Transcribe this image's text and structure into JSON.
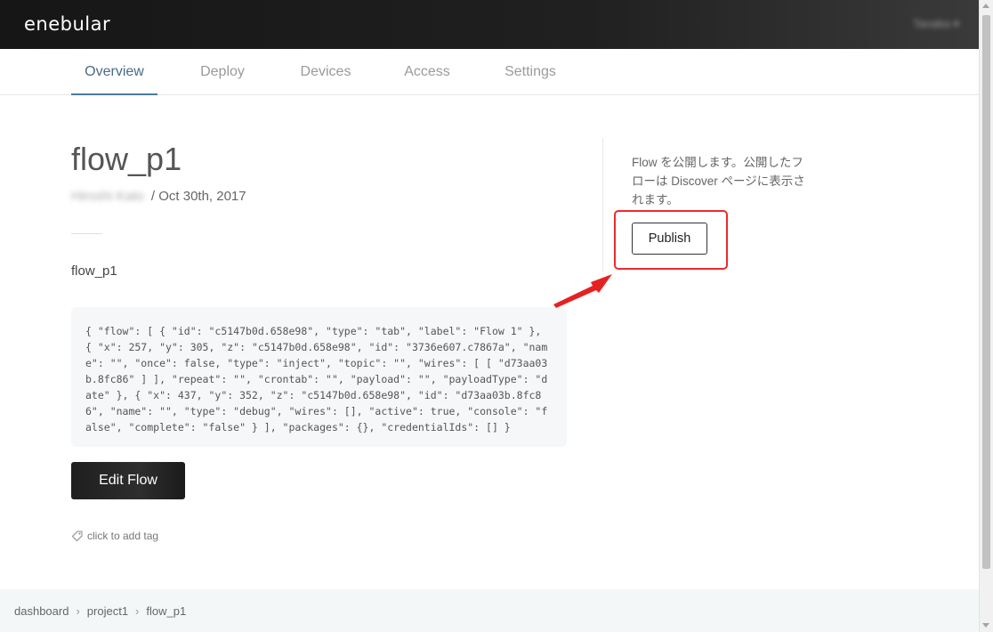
{
  "app": {
    "logo": "enebular",
    "user": "Tanaka"
  },
  "tabs": [
    {
      "label": "Overview",
      "active": true
    },
    {
      "label": "Deploy",
      "active": false
    },
    {
      "label": "Devices",
      "active": false
    },
    {
      "label": "Access",
      "active": false
    },
    {
      "label": "Settings",
      "active": false
    }
  ],
  "flow": {
    "title": "flow_p1",
    "author": "Hiroshi Kato",
    "date_sep": " / ",
    "date": "Oct 30th, 2017",
    "description": "flow_p1",
    "json": "{ \"flow\": [ { \"id\": \"c5147b0d.658e98\", \"type\": \"tab\", \"label\": \"Flow 1\" }, { \"x\": 257, \"y\": 305, \"z\": \"c5147b0d.658e98\", \"id\": \"3736e607.c7867a\", \"name\": \"\", \"once\": false, \"type\": \"inject\", \"topic\": \"\", \"wires\": [ [ \"d73aa03b.8fc86\" ] ], \"repeat\": \"\", \"crontab\": \"\", \"payload\": \"\", \"payloadType\": \"date\" }, { \"x\": 437, \"y\": 352, \"z\": \"c5147b0d.658e98\", \"id\": \"d73aa03b.8fc86\", \"name\": \"\", \"type\": \"debug\", \"wires\": [], \"active\": true, \"console\": \"false\", \"complete\": \"false\" } ], \"packages\": {}, \"credentialIds\": [] }",
    "edit_label": "Edit Flow",
    "tag_label": "click to add tag"
  },
  "publish": {
    "text": "Flow を公開します。公開したフローは Discover ページに表示されます。",
    "button_label": "Publish"
  },
  "breadcrumb": [
    "dashboard",
    "project1",
    "flow_p1"
  ],
  "colors": {
    "accent": "#4a7b9b",
    "highlight": "#ee2a2a"
  }
}
